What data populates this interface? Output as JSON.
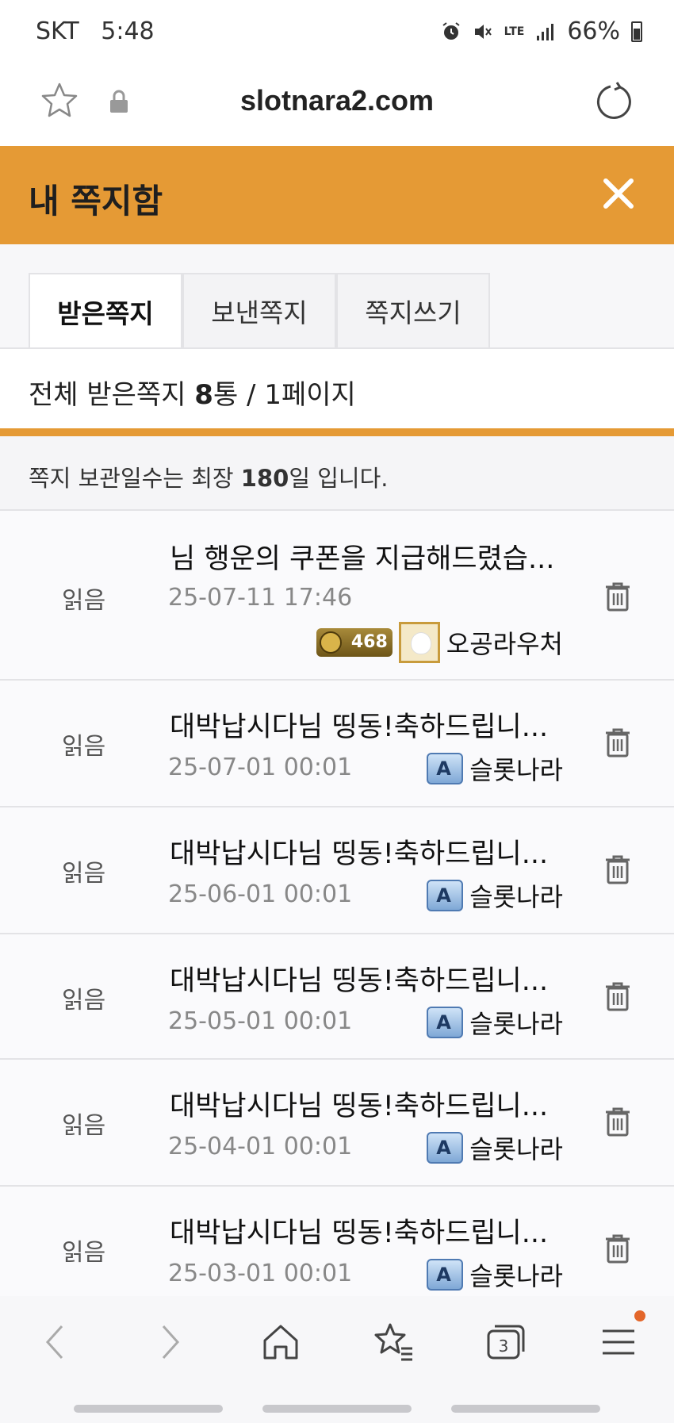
{
  "status_bar": {
    "carrier": "SKT",
    "time": "5:48",
    "network": "LTE",
    "battery": "66%"
  },
  "browser": {
    "url": "slotnara2.com"
  },
  "header": {
    "title": "내 쪽지함",
    "accent_color": "#e59a35"
  },
  "tabs": [
    {
      "label": "받은쪽지",
      "active": true
    },
    {
      "label": "보낸쪽지",
      "active": false
    },
    {
      "label": "쪽지쓰기",
      "active": false
    }
  ],
  "summary": {
    "prefix": "전체 받은쪽지 ",
    "count": "8",
    "suffix": "통 / 1페이지"
  },
  "retention": {
    "prefix": "쪽지 보관일수는 최장 ",
    "days": "180",
    "suffix": "일 입니다."
  },
  "messages": [
    {
      "status": "읽음",
      "title": "님 행운의 쿠폰을 지급해드렸습...",
      "date": "25-07-11 17:46",
      "sender": "오공라우처",
      "level": "468",
      "badge": "level-avatar"
    },
    {
      "status": "읽음",
      "title": "대박납시다님 띵동!축하드립니...",
      "date": "25-07-01 00:01",
      "sender": "슬롯나라",
      "badge_text": "A",
      "badge": "admin"
    },
    {
      "status": "읽음",
      "title": "대박납시다님 띵동!축하드립니...",
      "date": "25-06-01 00:01",
      "sender": "슬롯나라",
      "badge_text": "A",
      "badge": "admin"
    },
    {
      "status": "읽음",
      "title": "대박납시다님 띵동!축하드립니...",
      "date": "25-05-01 00:01",
      "sender": "슬롯나라",
      "badge_text": "A",
      "badge": "admin"
    },
    {
      "status": "읽음",
      "title": "대박납시다님 띵동!축하드립니...",
      "date": "25-04-01 00:01",
      "sender": "슬롯나라",
      "badge_text": "A",
      "badge": "admin"
    },
    {
      "status": "읽음",
      "title": "대박납시다님 띵동!축하드립니...",
      "date": "25-03-01 00:01",
      "sender": "슬롯나라",
      "badge_text": "A",
      "badge": "admin"
    }
  ],
  "bottom_nav": {
    "tabs_count": "3",
    "icons": [
      "back-icon",
      "forward-icon",
      "home-icon",
      "bookmarks-icon",
      "tabs-icon",
      "menu-icon"
    ]
  }
}
